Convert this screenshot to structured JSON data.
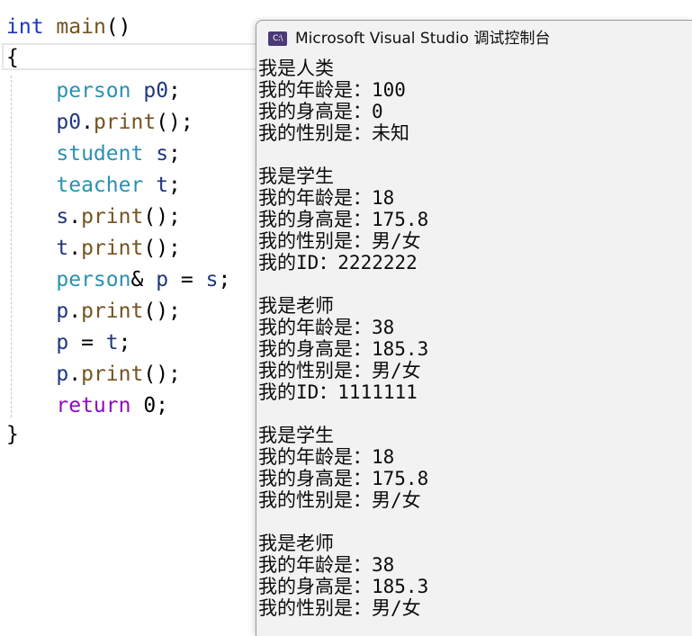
{
  "editor": {
    "lines": [
      {
        "tokens": [
          {
            "t": "int",
            "c": "kw"
          },
          {
            "t": " ",
            "c": "pl"
          },
          {
            "t": "main",
            "c": "fn"
          },
          {
            "t": "()",
            "c": "pl"
          }
        ]
      },
      {
        "tokens": [
          {
            "t": "{",
            "c": "pl"
          }
        ]
      },
      {
        "tokens": [
          {
            "t": "    ",
            "c": "pl"
          },
          {
            "t": "person",
            "c": "ty"
          },
          {
            "t": " ",
            "c": "pl"
          },
          {
            "t": "p0",
            "c": "va"
          },
          {
            "t": ";",
            "c": "pl"
          }
        ]
      },
      {
        "tokens": [
          {
            "t": "    ",
            "c": "pl"
          },
          {
            "t": "p0",
            "c": "va"
          },
          {
            "t": ".",
            "c": "pl"
          },
          {
            "t": "print",
            "c": "fn"
          },
          {
            "t": "();",
            "c": "pl"
          }
        ]
      },
      {
        "tokens": [
          {
            "t": "    ",
            "c": "pl"
          },
          {
            "t": "student",
            "c": "ty"
          },
          {
            "t": " ",
            "c": "pl"
          },
          {
            "t": "s",
            "c": "va"
          },
          {
            "t": ";",
            "c": "pl"
          }
        ]
      },
      {
        "tokens": [
          {
            "t": "    ",
            "c": "pl"
          },
          {
            "t": "teacher",
            "c": "ty"
          },
          {
            "t": " ",
            "c": "pl"
          },
          {
            "t": "t",
            "c": "va"
          },
          {
            "t": ";",
            "c": "pl"
          }
        ]
      },
      {
        "tokens": [
          {
            "t": "    ",
            "c": "pl"
          },
          {
            "t": "s",
            "c": "va"
          },
          {
            "t": ".",
            "c": "pl"
          },
          {
            "t": "print",
            "c": "fn"
          },
          {
            "t": "();",
            "c": "pl"
          }
        ]
      },
      {
        "tokens": [
          {
            "t": "    ",
            "c": "pl"
          },
          {
            "t": "t",
            "c": "va"
          },
          {
            "t": ".",
            "c": "pl"
          },
          {
            "t": "print",
            "c": "fn"
          },
          {
            "t": "();",
            "c": "pl"
          }
        ]
      },
      {
        "tokens": [
          {
            "t": "    ",
            "c": "pl"
          },
          {
            "t": "person",
            "c": "ty"
          },
          {
            "t": "& ",
            "c": "pl"
          },
          {
            "t": "p",
            "c": "va"
          },
          {
            "t": " = ",
            "c": "pl"
          },
          {
            "t": "s",
            "c": "va"
          },
          {
            "t": ";",
            "c": "pl"
          }
        ]
      },
      {
        "tokens": [
          {
            "t": "    ",
            "c": "pl"
          },
          {
            "t": "p",
            "c": "va"
          },
          {
            "t": ".",
            "c": "pl"
          },
          {
            "t": "print",
            "c": "fn"
          },
          {
            "t": "();",
            "c": "pl"
          }
        ]
      },
      {
        "tokens": [
          {
            "t": "    ",
            "c": "pl"
          },
          {
            "t": "p",
            "c": "va"
          },
          {
            "t": " = ",
            "c": "pl"
          },
          {
            "t": "t",
            "c": "va"
          },
          {
            "t": ";",
            "c": "pl"
          }
        ]
      },
      {
        "tokens": [
          {
            "t": "    ",
            "c": "pl"
          },
          {
            "t": "p",
            "c": "va"
          },
          {
            "t": ".",
            "c": "pl"
          },
          {
            "t": "print",
            "c": "fn"
          },
          {
            "t": "();",
            "c": "pl"
          }
        ]
      },
      {
        "tokens": [
          {
            "t": "    ",
            "c": "pl"
          },
          {
            "t": "return",
            "c": "ct"
          },
          {
            "t": " 0;",
            "c": "pl"
          }
        ]
      },
      {
        "tokens": [
          {
            "t": "}",
            "c": "pl"
          }
        ]
      }
    ]
  },
  "console": {
    "icon_text": "C:\\",
    "title": "Microsoft Visual Studio 调试控制台",
    "output": [
      "我是人类",
      "我的年龄是：100",
      "我的身高是：0",
      "我的性别是：未知",
      "",
      "我是学生",
      "我的年龄是：18",
      "我的身高是：175.8",
      "我的性别是：男/女",
      "我的ID：2222222",
      "",
      "我是老师",
      "我的年龄是：38",
      "我的身高是：185.3",
      "我的性别是：男/女",
      "我的ID：1111111",
      "",
      "我是学生",
      "我的年龄是：18",
      "我的身高是：175.8",
      "我的性别是：男/女",
      "",
      "我是老师",
      "我的年龄是：38",
      "我的身高是：185.3",
      "我的性别是：男/女"
    ]
  }
}
